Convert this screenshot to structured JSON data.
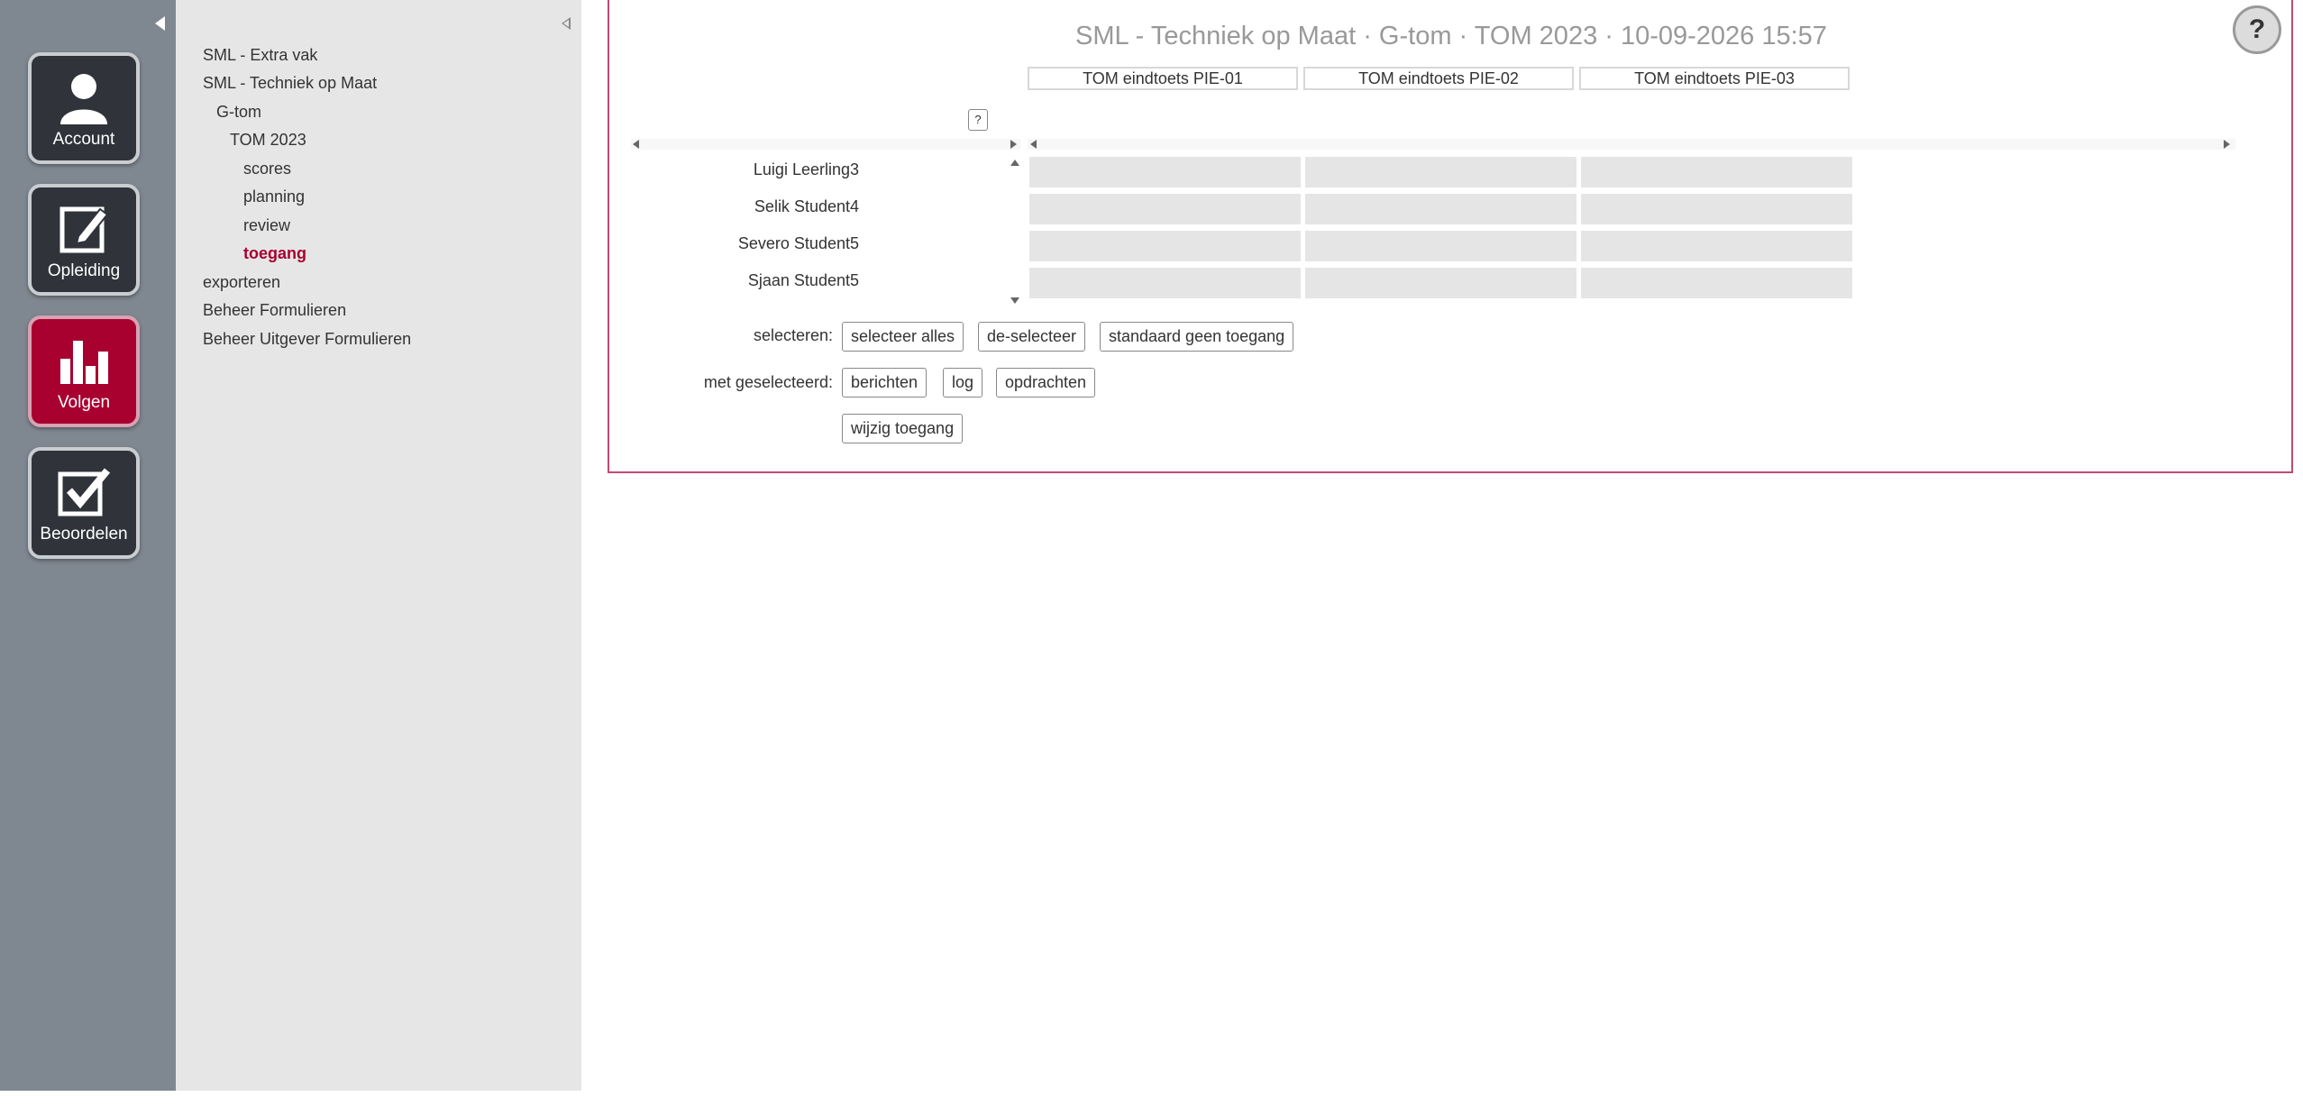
{
  "rail": {
    "buttons": [
      {
        "label": "Account",
        "icon": "account-icon"
      },
      {
        "label": "Opleiding",
        "icon": "edit-icon"
      },
      {
        "label": "Volgen",
        "icon": "bar-chart-icon",
        "active": true
      },
      {
        "label": "Beoordelen",
        "icon": "checkbox-icon"
      }
    ]
  },
  "tree": {
    "items": [
      {
        "label": "SML - Extra vak"
      },
      {
        "label": "SML - Techniek op Maat"
      },
      {
        "label": "G-tom"
      },
      {
        "label": "TOM 2023"
      },
      {
        "label": "scores"
      },
      {
        "label": "planning"
      },
      {
        "label": "review"
      },
      {
        "label": "toegang",
        "current": true
      },
      {
        "label": "exporteren"
      },
      {
        "label": "Beheer Formulieren"
      },
      {
        "label": "Beheer Uitgever Formulieren"
      }
    ]
  },
  "main": {
    "title": "SML - Techniek op Maat · G-tom · TOM 2023 · 10-09-2026 15:57",
    "help_label": "?",
    "small_help_label": "?",
    "columns": [
      "TOM eindtoets PIE-01",
      "TOM eindtoets PIE-02",
      "TOM eindtoets PIE-03"
    ],
    "students": [
      "Luigi Leerling3",
      "Selik Student4",
      "Severo Student5",
      "Sjaan Student5"
    ],
    "select_label": "selecteren:",
    "select_buttons": [
      "selecteer alles",
      "de-selecteer",
      "standaard geen toegang"
    ],
    "selected_label": "met geselecteerd:",
    "selected_buttons": [
      "berichten",
      "log",
      "opdrachten"
    ],
    "change_button": "wijzig toegang"
  },
  "colors": {
    "accent": "#a8002f",
    "rail_bg": "#7f8790",
    "tree_bg": "#e6e6e6",
    "frame_border": "#c24a72"
  }
}
